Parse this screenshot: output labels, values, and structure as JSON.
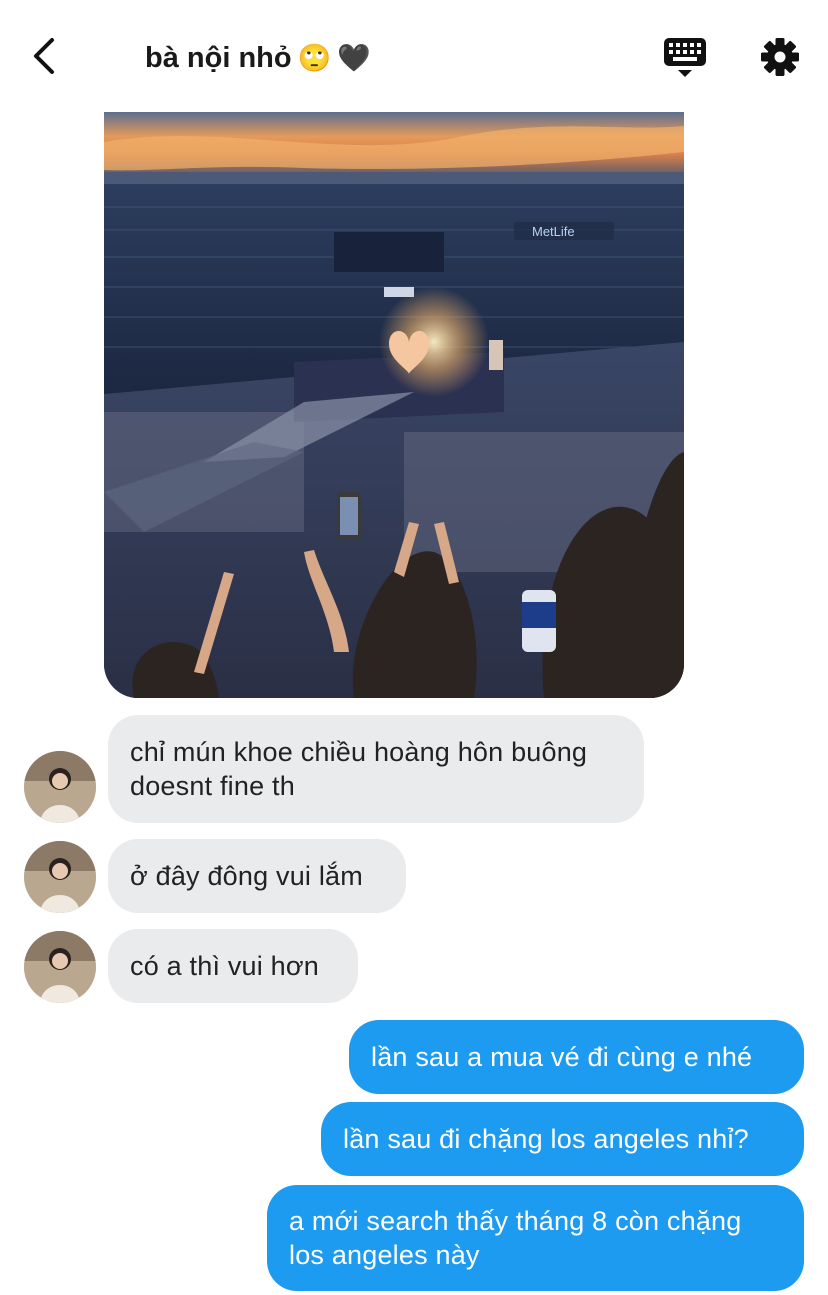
{
  "header": {
    "title": "bà nội nhỏ",
    "title_emoji_1": "🙄",
    "title_emoji_2": "🖤",
    "icons": [
      "back-chevron-icon",
      "keyboard-icon",
      "gear-icon"
    ]
  },
  "image_message": {
    "sign_text": "MetLife"
  },
  "messages": [
    {
      "side": "in",
      "lines": [
        "chỉ mún khoe chiều hoàng hôn buông",
        "doesnt fine th"
      ]
    },
    {
      "side": "in",
      "lines": [
        "ở đây đông vui lắm"
      ]
    },
    {
      "side": "in",
      "lines": [
        "có a thì vui hơn"
      ]
    },
    {
      "side": "out",
      "lines": [
        "lần sau a mua vé đi cùng e nhé"
      ]
    },
    {
      "side": "out",
      "lines": [
        "lần sau đi chặng los angeles nhỉ?"
      ]
    },
    {
      "side": "out",
      "lines": [
        "a mới search thấy tháng 8 còn chặng",
        "los angeles này"
      ]
    }
  ],
  "colors": {
    "incoming_bubble": "#eaebed",
    "outgoing_bubble": "#1d9bf0",
    "icon": "#111111"
  }
}
